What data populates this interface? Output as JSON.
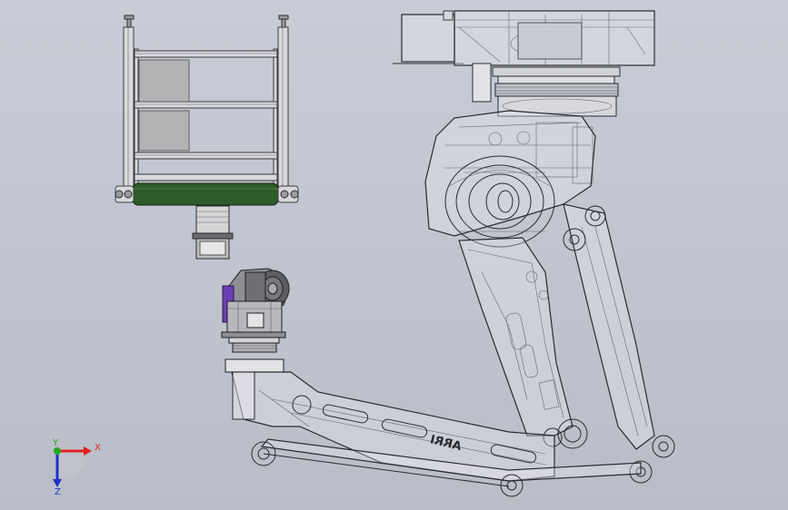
{
  "viewport": {
    "background_top": "#c9ccd6",
    "background_bottom": "#b9bdc8",
    "model_line_color": "#2a2b30"
  },
  "model": {
    "arm_logo_text": "ARRI"
  },
  "triad": {
    "x_label": "X",
    "y_label": "Y",
    "z_label": "Z",
    "x_color": "#e02020",
    "y_color": "#1faa1f",
    "z_color": "#2030c8"
  }
}
